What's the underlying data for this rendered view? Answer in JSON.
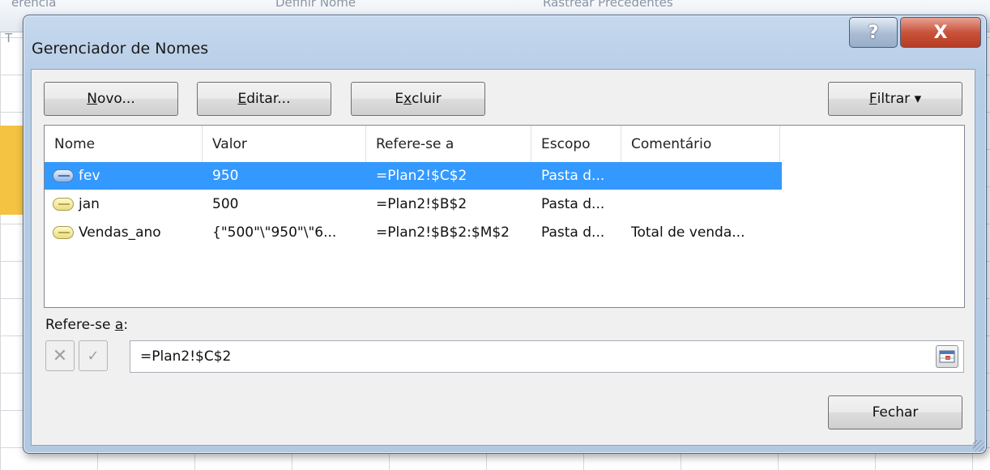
{
  "background": {
    "ribbon_text_1": "erencia",
    "ribbon_text_2": "Definir Nome",
    "ribbon_text_3": "Rastrear Precedentes",
    "ribbon_text_4": "T"
  },
  "dialog": {
    "title": "Gerenciador de Nomes",
    "help_label": "?",
    "close_label": "X"
  },
  "toolbar": {
    "new": {
      "prefix": "",
      "mnemonic": "N",
      "suffix": "ovo..."
    },
    "edit": {
      "prefix": "",
      "mnemonic": "E",
      "suffix": "ditar..."
    },
    "delete": {
      "prefix": "E",
      "mnemonic": "x",
      "suffix": "cluir"
    },
    "filter": {
      "prefix": "",
      "mnemonic": "F",
      "suffix": "iltrar ▾"
    }
  },
  "table": {
    "columns": [
      "Nome",
      "Valor",
      "Refere-se a",
      "Escopo",
      "Comentário"
    ],
    "rows": [
      {
        "nome": "fev",
        "valor": "950",
        "refere": "=Plan2!$C$2",
        "escopo": "Pasta d...",
        "comentario": "",
        "selected": true
      },
      {
        "nome": "jan",
        "valor": "500",
        "refere": "=Plan2!$B$2",
        "escopo": "Pasta d...",
        "comentario": "",
        "selected": false
      },
      {
        "nome": "Vendas_ano",
        "valor": "{\"500\"\\\"950\"\\\"6...",
        "refere": "=Plan2!$B$2:$M$2",
        "escopo": "Pasta d...",
        "comentario": "Total de venda...",
        "selected": false
      }
    ]
  },
  "refers_to": {
    "label_prefix": "Refere-se ",
    "label_mnemonic": "a",
    "label_suffix": ":",
    "value": "=Plan2!$C$2",
    "cancel_icon": "✕",
    "confirm_icon": "✓"
  },
  "footer": {
    "close_label": "Fechar"
  },
  "colors": {
    "selection": "#3399ff",
    "close_button": "#c9533b"
  }
}
